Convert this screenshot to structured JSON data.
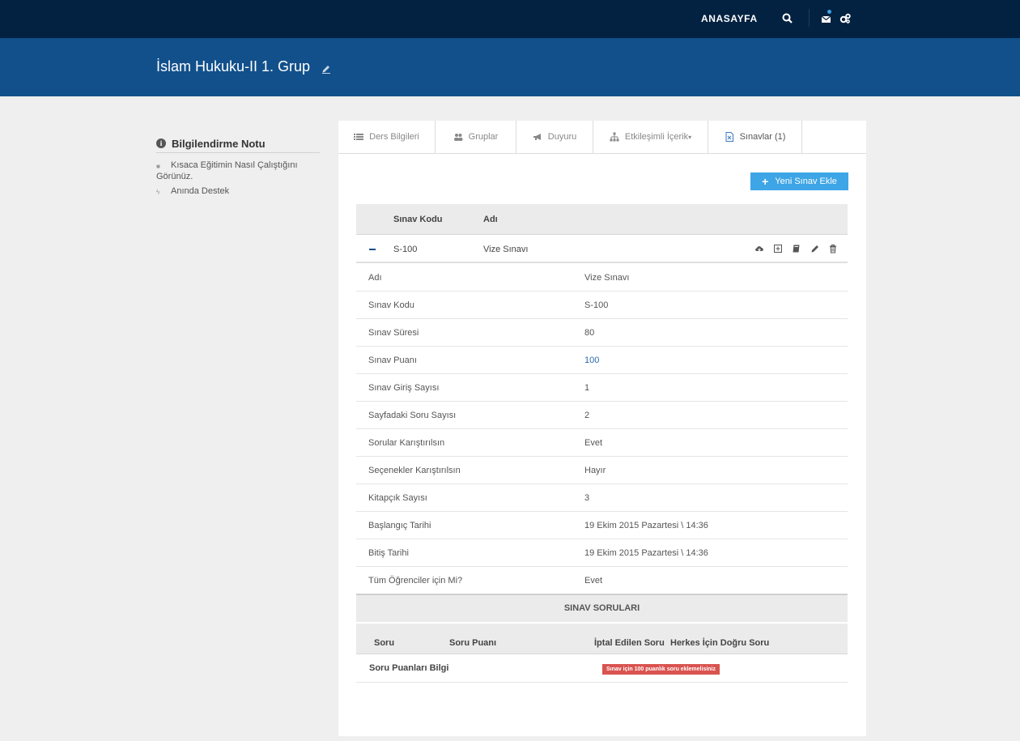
{
  "topbar": {
    "home_label": "ANASAYFA",
    "icons": [
      "search-icon",
      "envelope-icon",
      "cogs-icon"
    ]
  },
  "hero": {
    "title": "İslam Hukuku-II 1. Grup"
  },
  "sidebar": {
    "heading": "Bilgilendirme Notu",
    "items": [
      {
        "icon": "camera-icon",
        "label": "Kısaca Eğitimin Nasıl Çalıştığını Görünüz."
      },
      {
        "icon": "bolt-icon",
        "label": "Anında Destek"
      }
    ]
  },
  "tabs": [
    {
      "icon": "list-icon",
      "label": "Ders Bilgileri"
    },
    {
      "icon": "users-icon",
      "label": "Gruplar"
    },
    {
      "icon": "bullhorn-icon",
      "label": "Duyuru"
    },
    {
      "icon": "sitemap-icon",
      "label": "Etkileşimli İçerik",
      "caret": "▾"
    },
    {
      "icon": "file-excel-icon",
      "label": "Sınavlar (1)"
    }
  ],
  "add_button": {
    "label": "Yeni Sınav Ekle"
  },
  "exam_table": {
    "headers": {
      "code": "Sınav Kodu",
      "name": "Adı"
    },
    "row": {
      "code": "S-100",
      "name": "Vize Sınavı"
    }
  },
  "details": [
    {
      "key": "Adı",
      "value": "Vize Sınavı"
    },
    {
      "key": "Sınav Kodu",
      "value": "S-100"
    },
    {
      "key": "Sınav Süresi",
      "value": "80"
    },
    {
      "key": "Sınav Puanı",
      "value": "100"
    },
    {
      "key": "Sınav Giriş Sayısı",
      "value": "1"
    },
    {
      "key": "Sayfadaki Soru Sayısı",
      "value": "2"
    },
    {
      "key": "Sorular Karıştırılsın",
      "value": "Evet"
    },
    {
      "key": "Seçenekler Karıştırılsın",
      "value": "Hayır"
    },
    {
      "key": "Kitapçık Sayısı",
      "value": "3"
    },
    {
      "key": "Başlangıç Tarihi",
      "value": "19 Ekim 2015 Pazartesi \\ 14:36"
    },
    {
      "key": "Bitiş Tarihi",
      "value": "19 Ekim 2015 Pazartesi \\ 14:36"
    },
    {
      "key": "Tüm Öğrenciler için Mi?",
      "value": "Evet"
    }
  ],
  "questions": {
    "title": "SINAV SORULARI",
    "headers": {
      "soru": "Soru",
      "puan": "Soru Puanı",
      "iptal": "İptal Edilen Soru",
      "herkes": "Herkes İçin Doğru Soru"
    },
    "info_label": "Soru Puanları Bilgi",
    "warning": "Sınav için 100 puanlık soru eklemelisiniz"
  },
  "colors": {
    "topbar": "#032140",
    "hero": "#11508b",
    "button": "#3ea5e6",
    "warning": "#d9534f",
    "link": "#2a6ab0"
  }
}
